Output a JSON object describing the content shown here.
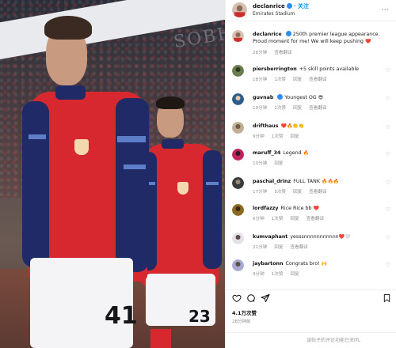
{
  "post": {
    "username": "declanrice",
    "follow_label": "· 关注",
    "location": "Emirates Stadium",
    "more_label": "···"
  },
  "photo": {
    "banner_text": "SOBHA",
    "player_front_number": "41",
    "player_back_number": "23"
  },
  "comments": [
    {
      "user": "declanrice",
      "verified": true,
      "text": "250th premier league appearance. Proud moment for me! We will keep pushing",
      "emoji": "❤️",
      "time": "28分钟",
      "likes": "",
      "translate": "查看翻译",
      "reply": ""
    },
    {
      "user": "piersberrington",
      "verified": false,
      "text": "+5 skill points available",
      "emoji": "",
      "time": "18分钟",
      "likes": "1次赞",
      "translate": "查看翻译",
      "reply": "回复"
    },
    {
      "user": "guvnab",
      "verified": true,
      "text": "Youngest OG",
      "emoji": "😎",
      "time": "19分钟",
      "likes": "1次赞",
      "translate": "查看翻译",
      "reply": "回复"
    },
    {
      "user": "drifthaus",
      "verified": false,
      "text": "",
      "emoji": "❤️🔥👏👏",
      "time": "9分钟",
      "likes": "1次赞",
      "translate": "",
      "reply": "回复"
    },
    {
      "user": "maruff_34",
      "verified": false,
      "text": "Legend",
      "emoji": "🔥",
      "time": "10分钟",
      "likes": "",
      "translate": "",
      "reply": "回复"
    },
    {
      "user": "paschal_drinz",
      "verified": false,
      "text": "FULL TANK",
      "emoji": "🔥🔥🔥",
      "time": "17分钟",
      "likes": "5次赞",
      "translate": "查看翻译",
      "reply": "回复"
    },
    {
      "user": "lordfazzy",
      "verified": false,
      "text": "Rice Rice bb",
      "emoji": "❤️",
      "time": "6分钟",
      "likes": "1次赞",
      "translate": "查看翻译",
      "reply": "回复"
    },
    {
      "user": "kumvaphant",
      "verified": false,
      "text": "yesssnnnnnnnnnnn",
      "emoji": "❤️🤍",
      "time": "21分钟",
      "likes": "",
      "translate": "查看翻译",
      "reply": "回复"
    },
    {
      "user": "jaybartonn",
      "verified": false,
      "text": "Congrats bro!",
      "emoji": "🙌",
      "time": "9分钟",
      "likes": "1次赞",
      "translate": "",
      "reply": "回复"
    }
  ],
  "engagement": {
    "likes": "4.1万次赞",
    "time": "28分钟前",
    "comments_disabled": "该帖子的评论功能已关闭。"
  },
  "colors": {
    "accent": "#0095f6",
    "verified": "#2f8cf0",
    "arsenal_red": "#d8282f",
    "arsenal_navy": "#1f2a66"
  },
  "icons": [
    "heart-icon",
    "comment-icon",
    "share-icon",
    "bookmark-icon",
    "verified-icon",
    "more-icon"
  ]
}
